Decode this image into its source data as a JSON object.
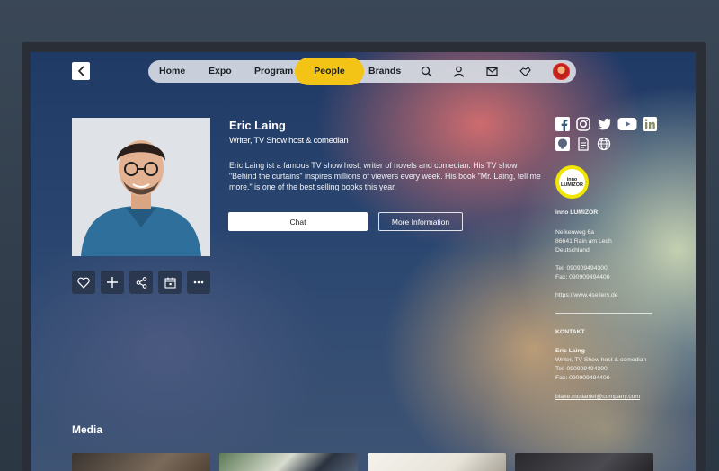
{
  "nav": {
    "items": [
      "Home",
      "Expo",
      "Program",
      "People",
      "Brands"
    ],
    "active": "People",
    "accent": "#f3c315"
  },
  "profile": {
    "name": "Eric Laing",
    "role": "Writer, TV Show host & comedian",
    "bio": "Eric Laing ist a famous TV show host, writer of novels and comedian. His TV show \"Behind the curtains\" inspires millions of viewers every week. His book \"Mr. Laing, tell me more.\" is one of the best selling books this year.",
    "chat_label": "Chat",
    "info_label": "More Information"
  },
  "company": {
    "logo_line1": "inno",
    "logo_line2": "LUMIZOR",
    "name": "inno LUMIZOR",
    "street": "Nelkenweg 6a",
    "city": "86641 Rain am Lech",
    "country": "Deutschland",
    "tel": "Tel: 090909494300",
    "fax": "Fax: 090909494400",
    "website": "https://www.4sellers.de"
  },
  "contact": {
    "heading": "KONTAKT",
    "name": "Eric Laing",
    "role": "Writer, TV Show host & comedian",
    "tel": "Tel: 090909494300",
    "fax": "Fax: 090909494400",
    "email": "blake.mcdaniel@company.com"
  },
  "media": {
    "title": "Media"
  }
}
